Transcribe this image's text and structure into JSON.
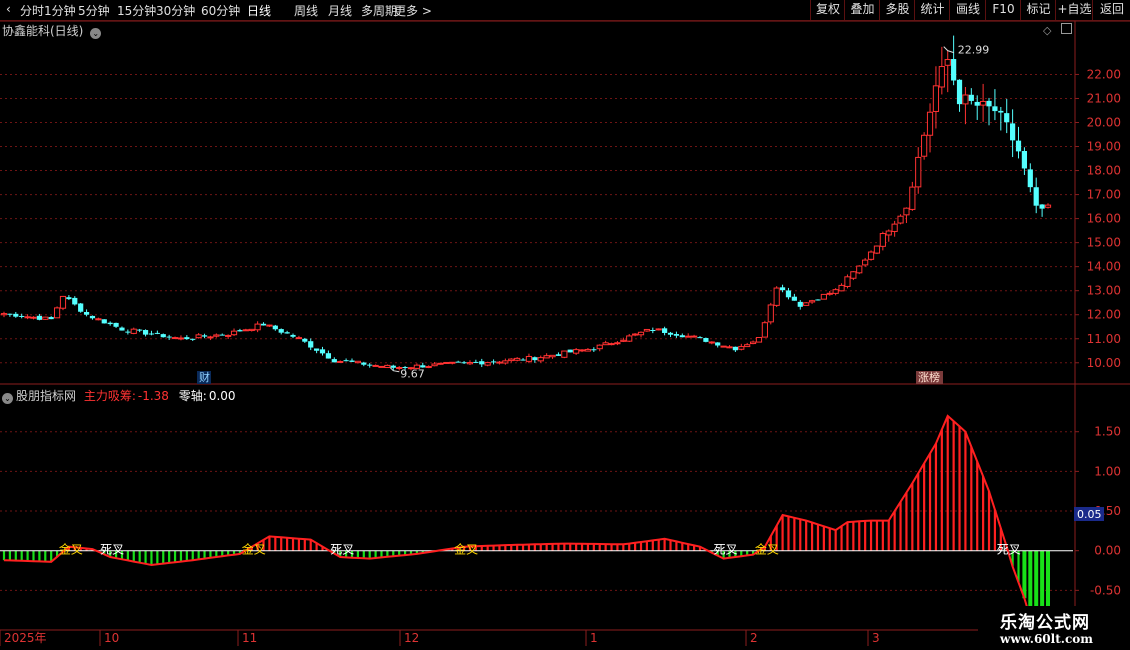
{
  "toolbar": {
    "left_items": [
      "分时",
      "1分钟",
      "5分钟",
      "15分钟",
      "30分钟",
      "60分钟",
      "日线",
      "周线",
      "月线",
      "多周期",
      "更多 >"
    ],
    "active_index": 6,
    "right_items": [
      "复权",
      "叠加",
      "多股",
      "统计",
      "画线",
      "F10",
      "标记",
      "+自选",
      "返回"
    ]
  },
  "main_title": "协鑫能科(日线)",
  "indicator": {
    "name": "股朋指标网",
    "series_label": "主力吸筹:",
    "series_value": "-1.38",
    "zero_label": "零轴:",
    "zero_value": "0.00",
    "current_tag": "0.05"
  },
  "markers": {
    "high_label": "22.99",
    "low_label": "9.67",
    "news_tag_cai": "财",
    "news_tag_zhangting": "涨榜"
  },
  "logo": {
    "line1": "乐淘公式网",
    "line2": "www.60lt.com"
  },
  "colors": {
    "up": "#ff3232",
    "down": "#54ffff",
    "grid": "#6e1414",
    "axis": "#8c1e1e",
    "bar_up": "#ff2020",
    "bar_down": "#18e018",
    "curve": "#ff2020",
    "cross_label": "#ffd700",
    "dead_label": "#ffffff"
  },
  "chart_data": [
    {
      "type": "candlestick",
      "title": "协鑫能科(日线)",
      "y_ticks": [
        10.0,
        11.0,
        12.0,
        13.0,
        14.0,
        15.0,
        16.0,
        17.0,
        18.0,
        19.0,
        20.0,
        21.0,
        22.0
      ],
      "y_tick_labels": [
        "10.00",
        "11.00",
        "12.00",
        "13.00",
        "14.00",
        "15.00",
        "16.00",
        "17.00",
        "18.00",
        "19.00",
        "20.00",
        "21.00",
        "22.00"
      ],
      "ylim": [
        9.2,
        23.6
      ],
      "x_labels": [
        "2025年",
        "10",
        "11",
        "12",
        "1",
        "2",
        "3"
      ],
      "price_anchors": [
        [
          0,
          12.05
        ],
        [
          8,
          11.8
        ],
        [
          10,
          12.8
        ],
        [
          14,
          12.0
        ],
        [
          20,
          11.4
        ],
        [
          30,
          11.0
        ],
        [
          38,
          11.2
        ],
        [
          44,
          11.6
        ],
        [
          50,
          11.0
        ],
        [
          56,
          10.1
        ],
        [
          66,
          9.8
        ],
        [
          80,
          10.0
        ],
        [
          90,
          10.2
        ],
        [
          100,
          10.6
        ],
        [
          110,
          11.4
        ],
        [
          118,
          11.0
        ],
        [
          124,
          10.6
        ],
        [
          128,
          11.0
        ],
        [
          131,
          13.2
        ],
        [
          135,
          12.4
        ],
        [
          141,
          13.0
        ],
        [
          145,
          14.0
        ],
        [
          150,
          15.6
        ],
        [
          153,
          16.5
        ],
        [
          156,
          19.5
        ],
        [
          158,
          21.5
        ],
        [
          160,
          22.6
        ],
        [
          162,
          21.0
        ],
        [
          165,
          20.7
        ],
        [
          168,
          20.5
        ],
        [
          170,
          19.8
        ],
        [
          172,
          18.8
        ],
        [
          175,
          16.4
        ],
        [
          177,
          16.4
        ]
      ],
      "high": 22.99,
      "low": 9.67,
      "count": 178
    },
    {
      "type": "bar",
      "title": "股朋指标网",
      "series": [
        {
          "name": "主力吸筹",
          "last": -1.38
        }
      ],
      "y_ticks": [
        1.5,
        1.0,
        0.5,
        0.0,
        -0.5
      ],
      "y_tick_labels": [
        "1.50",
        "1.00",
        "0.50",
        "0.00",
        "-0.50"
      ],
      "ylim": [
        -1.0,
        1.9
      ],
      "osc_anchors": [
        [
          0,
          -0.12
        ],
        [
          8,
          -0.14
        ],
        [
          11,
          0.05
        ],
        [
          15,
          0.02
        ],
        [
          18,
          -0.08
        ],
        [
          25,
          -0.18
        ],
        [
          32,
          -0.12
        ],
        [
          40,
          -0.04
        ],
        [
          45,
          0.18
        ],
        [
          52,
          0.14
        ],
        [
          57,
          -0.08
        ],
        [
          62,
          -0.1
        ],
        [
          70,
          -0.04
        ],
        [
          78,
          0.05
        ],
        [
          85,
          0.07
        ],
        [
          95,
          0.09
        ],
        [
          105,
          0.08
        ],
        [
          112,
          0.15
        ],
        [
          118,
          0.05
        ],
        [
          122,
          -0.1
        ],
        [
          127,
          -0.05
        ],
        [
          129,
          0.05
        ],
        [
          132,
          0.45
        ],
        [
          136,
          0.38
        ],
        [
          141,
          0.26
        ],
        [
          143,
          0.36
        ],
        [
          147,
          0.38
        ],
        [
          150,
          0.38
        ],
        [
          154,
          0.85
        ],
        [
          158,
          1.35
        ],
        [
          160,
          1.7
        ],
        [
          163,
          1.5
        ],
        [
          167,
          0.75
        ],
        [
          170,
          0.05
        ],
        [
          171,
          -0.2
        ],
        [
          173,
          -0.6
        ],
        [
          175,
          -1.1
        ],
        [
          177,
          -1.38
        ]
      ],
      "annotations": [
        {
          "text": "金叉",
          "at": 11
        },
        {
          "text": "死叉",
          "at": 18
        },
        {
          "text": "金叉",
          "at": 42
        },
        {
          "text": "死叉",
          "at": 57
        },
        {
          "text": "金叉",
          "at": 78
        },
        {
          "text": "死叉",
          "at": 122
        },
        {
          "text": "金叉",
          "at": 129
        },
        {
          "text": "死叉",
          "at": 170
        }
      ]
    }
  ]
}
